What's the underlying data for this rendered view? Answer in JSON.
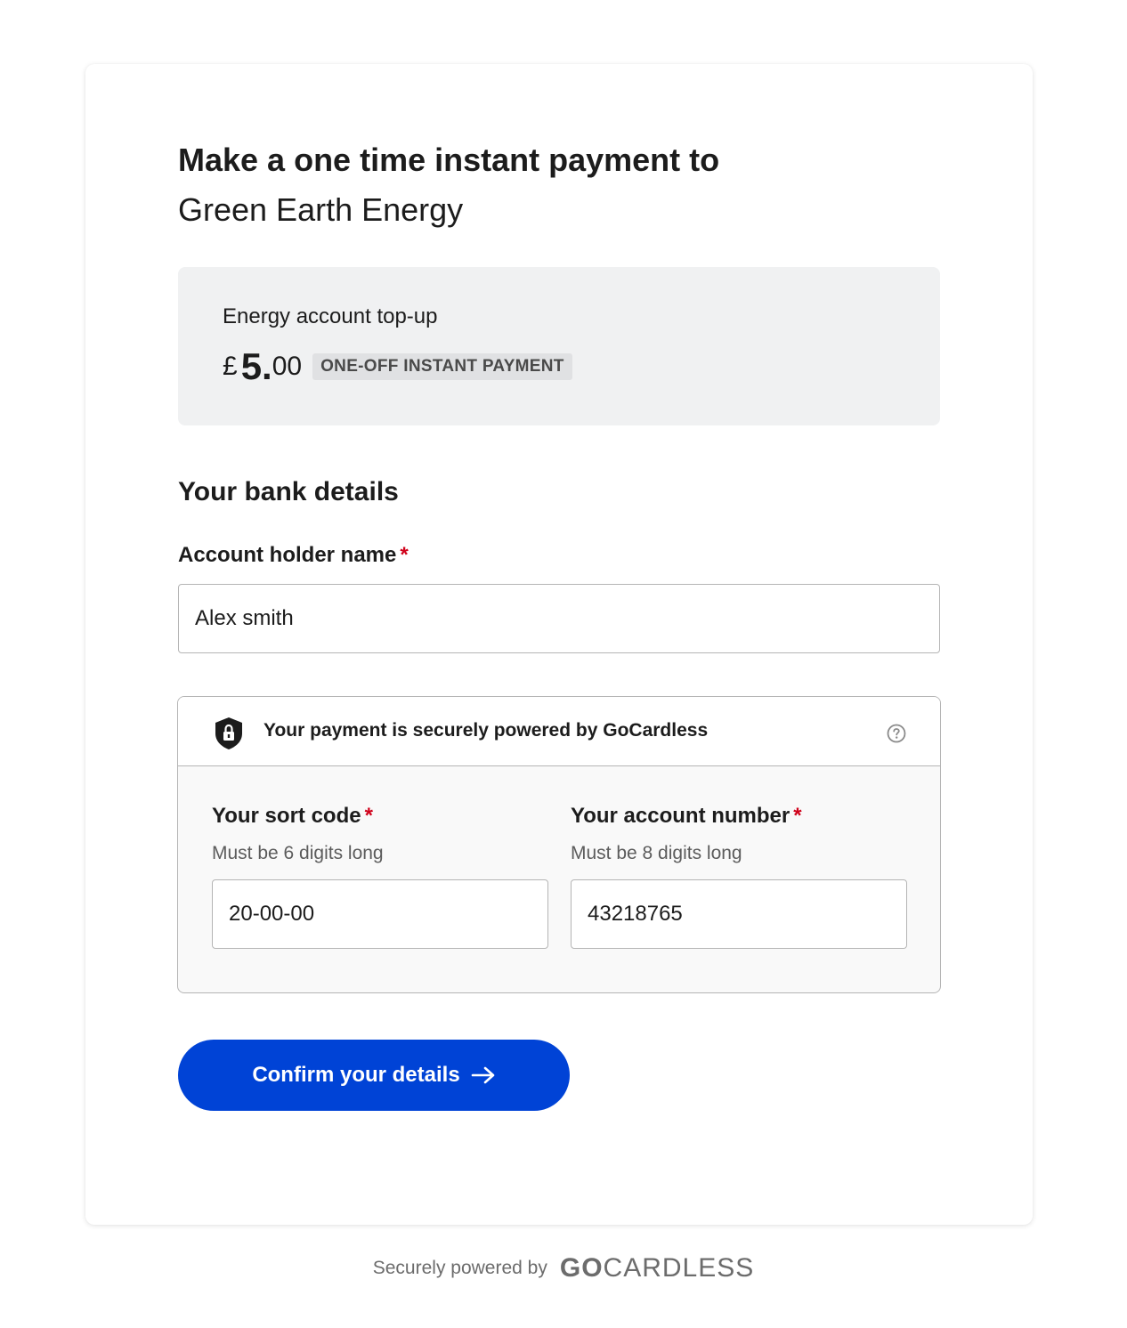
{
  "header": {
    "title": "Make a one time instant payment to",
    "merchant": "Green Earth Energy"
  },
  "summary": {
    "description": "Energy account top-up",
    "currency": "£",
    "amount_major": "5.",
    "amount_minor": "00",
    "badge": "ONE-OFF INSTANT PAYMENT"
  },
  "bank_details": {
    "section_title": "Your bank details",
    "account_holder": {
      "label": "Account holder name",
      "required_mark": "*",
      "value": "Alex smith"
    },
    "secure_notice": "Your payment is securely powered by GoCardless",
    "sort_code": {
      "label": "Your sort code",
      "required_mark": "*",
      "hint": "Must be 6 digits long",
      "value": "20-00-00"
    },
    "account_number": {
      "label": "Your account number",
      "required_mark": "*",
      "hint": "Must be 8 digits long",
      "value": "43218765"
    }
  },
  "confirm_button": {
    "label": "Confirm your details",
    "icon": "arrow-right-icon"
  },
  "footer": {
    "text": "Securely powered by",
    "logo_go": "GO",
    "logo_rest": "CARDLESS"
  },
  "icons": {
    "shield": "shield-lock-icon",
    "help": "question-circle-icon"
  },
  "colors": {
    "primary": "#0043d6",
    "required": "#d0021b",
    "summary_bg": "#f0f1f2",
    "secure_bg": "#f9f9f9"
  }
}
